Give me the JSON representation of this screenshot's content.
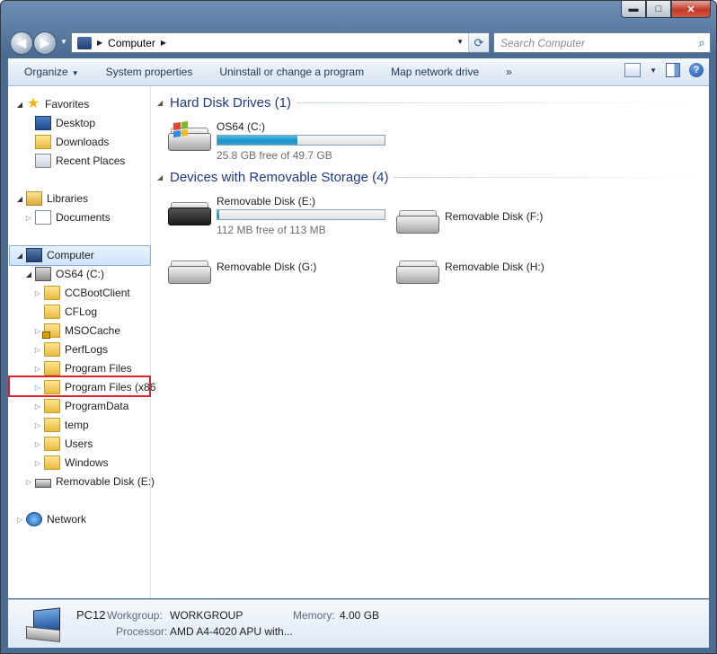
{
  "window": {
    "caption_buttons": {
      "min": "▬",
      "max": "□",
      "close": "✕"
    }
  },
  "nav": {
    "back_icon": "◀",
    "forward_icon": "▶",
    "history_dropdown": "▼",
    "address": {
      "sep": "▶",
      "path": "Computer",
      "sep_after": "▶",
      "dropdown": "▼"
    },
    "refresh_icon": "⟳",
    "search": {
      "placeholder": "Search Computer",
      "icon": "⌕"
    }
  },
  "commandbar": {
    "organize": "Organize",
    "organize_dd": "▼",
    "system_properties": "System properties",
    "uninstall": "Uninstall or change a program",
    "map_drive": "Map network drive",
    "more": "»",
    "views_dd": "▼",
    "help": "?"
  },
  "tree": {
    "favorites": "Favorites",
    "desktop": "Desktop",
    "downloads": "Downloads",
    "recent_places": "Recent Places",
    "libraries": "Libraries",
    "documents": "Documents",
    "computer": "Computer",
    "os64": "OS64 (C:)",
    "folders": [
      "CCBootClient",
      "CFLog",
      "MSOCache",
      "PerfLogs",
      "Program Files",
      "Program Files (x86",
      "ProgramData",
      "temp",
      "Users",
      "Windows"
    ],
    "removable_e": "Removable Disk (E:)",
    "network": "Network",
    "glyph_open": "◢",
    "glyph_closed": "▷"
  },
  "main": {
    "group_hdd": "Hard Disk Drives (1)",
    "group_removable": "Devices with Removable Storage (4)",
    "collapse_glyph": "◢",
    "drives": {
      "c": {
        "name": "OS64 (C:)",
        "free": "25.8 GB free of 49.7 GB",
        "used_fraction": 0.48
      },
      "e": {
        "name": "Removable Disk (E:)",
        "free": "112 MB free of 113 MB",
        "used_fraction": 0.01
      },
      "f": {
        "name": "Removable Disk (F:)"
      },
      "g": {
        "name": "Removable Disk (G:)"
      },
      "h": {
        "name": "Removable Disk (H:)"
      }
    }
  },
  "details": {
    "pc_name": "PC12",
    "workgroup_label": "Workgroup:",
    "workgroup": "WORKGROUP",
    "memory_label": "Memory:",
    "memory": "4.00 GB",
    "processor_label": "Processor:",
    "processor": "AMD A4-4020 APU with..."
  },
  "colors": {
    "accent_title": "#1e3a87",
    "highlight_box": "#e0202a",
    "bar_fill": "#1f8fc6"
  }
}
